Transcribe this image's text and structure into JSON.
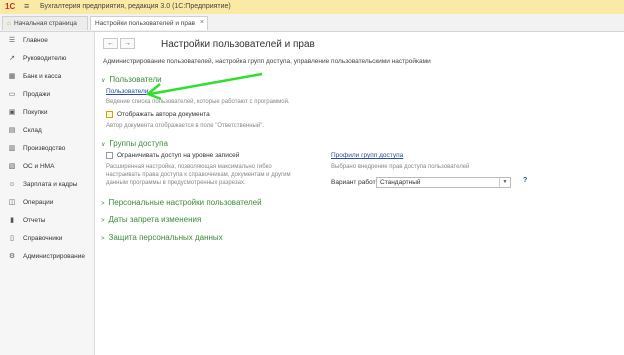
{
  "window": {
    "logo": "1С",
    "menu_icon": "hamburger-icon",
    "title": "Бухгалтерия предприятия, редакция 3.0  (1С:Предприятие)"
  },
  "tabs": [
    {
      "label": "Начальная страница",
      "icon": "home-icon"
    },
    {
      "label": "Настройки пользователей и прав",
      "close": "×"
    }
  ],
  "sidebar": {
    "items": [
      {
        "label": "Главное",
        "icon": "menu-icon"
      },
      {
        "label": "Руководителю",
        "icon": "chart-icon"
      },
      {
        "label": "Банк и касса",
        "icon": "bank-icon"
      },
      {
        "label": "Продажи",
        "icon": "cart-icon"
      },
      {
        "label": "Покупки",
        "icon": "purchase-icon"
      },
      {
        "label": "Склад",
        "icon": "warehouse-icon"
      },
      {
        "label": "Производство",
        "icon": "factory-icon"
      },
      {
        "label": "ОС и НМА",
        "icon": "assets-icon"
      },
      {
        "label": "Зарплата и кадры",
        "icon": "people-icon"
      },
      {
        "label": "Операции",
        "icon": "operations-icon"
      },
      {
        "label": "Отчеты",
        "icon": "reports-icon"
      },
      {
        "label": "Справочники",
        "icon": "book-icon"
      },
      {
        "label": "Администрирование",
        "icon": "gear-icon"
      }
    ]
  },
  "main": {
    "back": "←",
    "forward": "→",
    "title": "Настройки пользователей и прав",
    "description": "Администрирование пользователей, настройка групп доступа, управление пользовательскими настройками",
    "users_section": {
      "header": "Пользователи",
      "link": "Пользователи",
      "link_hint": "Ведение списка пользователей, которые работают с программой.",
      "checkbox_label": "Отображать автора документа",
      "checkbox_hint": "Автор документа отображается в поле \"Ответственный\"."
    },
    "access_section": {
      "header": "Группы доступа",
      "checkbox_label": "Ограничивать доступ на уровне записей",
      "hint_lines": [
        "Расширенная настройка, позволяющая максимально гибко",
        "настраивать права доступа к справочникам, документам и другим",
        "данным программы в предусмотренных разрезах."
      ],
      "profiles_link": "Профили групп доступа",
      "profiles_hint": "Выбрано внедрение прав доступа пользователей",
      "work_mode_label": "Вариант работы:",
      "work_mode_value": "Стандартный",
      "help": "?"
    },
    "collapsed_sections": [
      "Персональные настройки пользователей",
      "Даты запрета изменения",
      "Защита персональных данных"
    ]
  }
}
